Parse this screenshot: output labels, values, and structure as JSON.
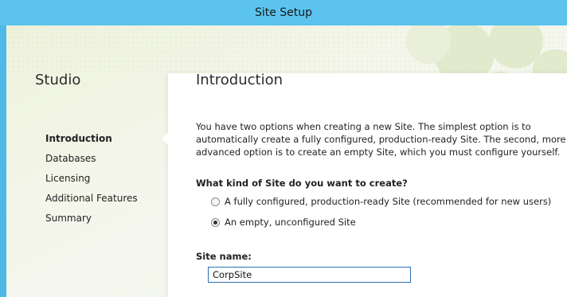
{
  "window": {
    "title": "Site Setup"
  },
  "sidebar": {
    "title": "Studio",
    "items": [
      {
        "label": "Introduction",
        "active": true
      },
      {
        "label": "Databases",
        "active": false
      },
      {
        "label": "Licensing",
        "active": false
      },
      {
        "label": "Additional Features",
        "active": false
      },
      {
        "label": "Summary",
        "active": false
      }
    ]
  },
  "main": {
    "title": "Introduction",
    "intro_text": "You have two options when creating a new Site. The simplest option is to automatically create a fully configured, production-ready Site. The second, more advanced option is to create an empty Site, which you must configure yourself.",
    "question": "What kind of Site do you want to create?",
    "options": [
      {
        "label": "A fully configured, production-ready Site (recommended for new users)",
        "selected": false
      },
      {
        "label": "An empty, unconfigured Site",
        "selected": true
      }
    ],
    "site_name_label": "Site name:",
    "site_name_value": "CorpSite"
  },
  "colors": {
    "titlebar": "#5bc3ee",
    "frame": "#4db9e6",
    "background": "#f3f6ea",
    "panel": "#ffffff",
    "input_border": "#2c6fb3"
  }
}
